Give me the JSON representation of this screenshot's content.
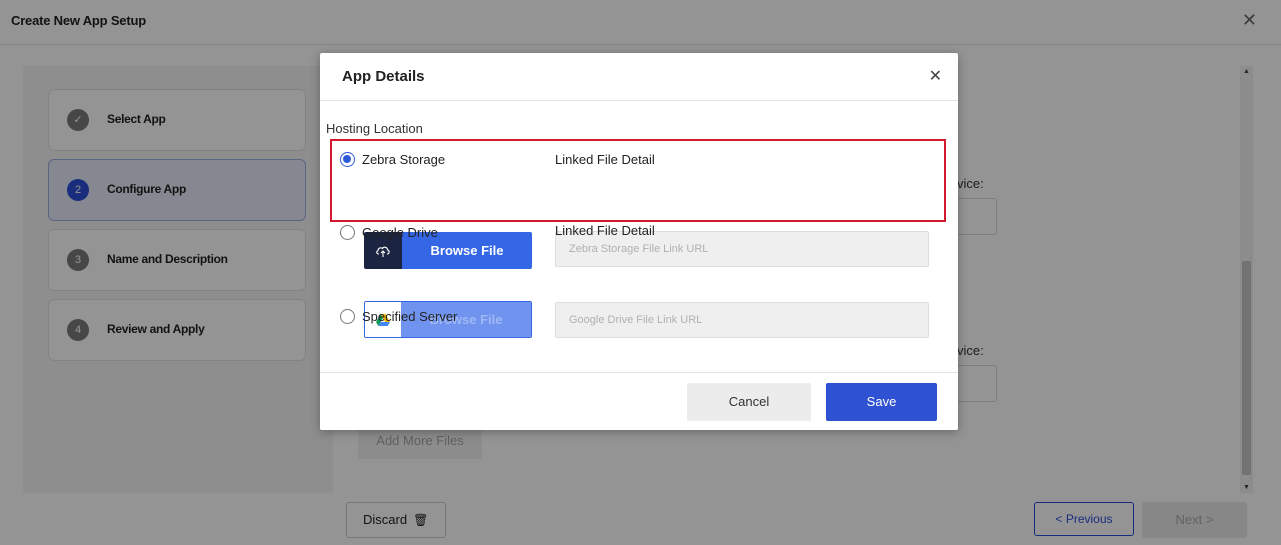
{
  "page": {
    "title": "Create New App Setup"
  },
  "steps": [
    {
      "number": "✓",
      "label": "Select App",
      "state": "done"
    },
    {
      "number": "2",
      "label": "Configure App",
      "state": "active"
    },
    {
      "number": "3",
      "label": "Name and Description",
      "state": "pending"
    },
    {
      "number": "4",
      "label": "Review and Apply",
      "state": "pending"
    }
  ],
  "background": {
    "device_label_1": "vice:",
    "device_label_2": "vice:",
    "add_more_label": "Add More Files",
    "discard_label": "Discard",
    "previous_label": "< Previous",
    "next_label": "Next >"
  },
  "modal": {
    "title": "App Details",
    "hosting_label": "Hosting Location",
    "options": {
      "zebra": {
        "label": "Zebra Storage",
        "checked": true,
        "linked_label": "Linked File Detail",
        "browse_label": "Browse File",
        "url_placeholder": "Zebra Storage File Link URL"
      },
      "gdrive": {
        "label": "Google Drive",
        "checked": false,
        "linked_label": "Linked File Detail",
        "browse_label": "Browse File",
        "url_placeholder": "Google Drive File Link URL"
      },
      "server": {
        "label": "Specified Server",
        "checked": false,
        "value": ""
      }
    },
    "cancel_label": "Cancel",
    "save_label": "Save"
  },
  "colors": {
    "primary": "#2f52d3",
    "browse_blue": "#3566e6",
    "highlight": "#d21a2e",
    "dark_icon_box": "#1b2542"
  }
}
